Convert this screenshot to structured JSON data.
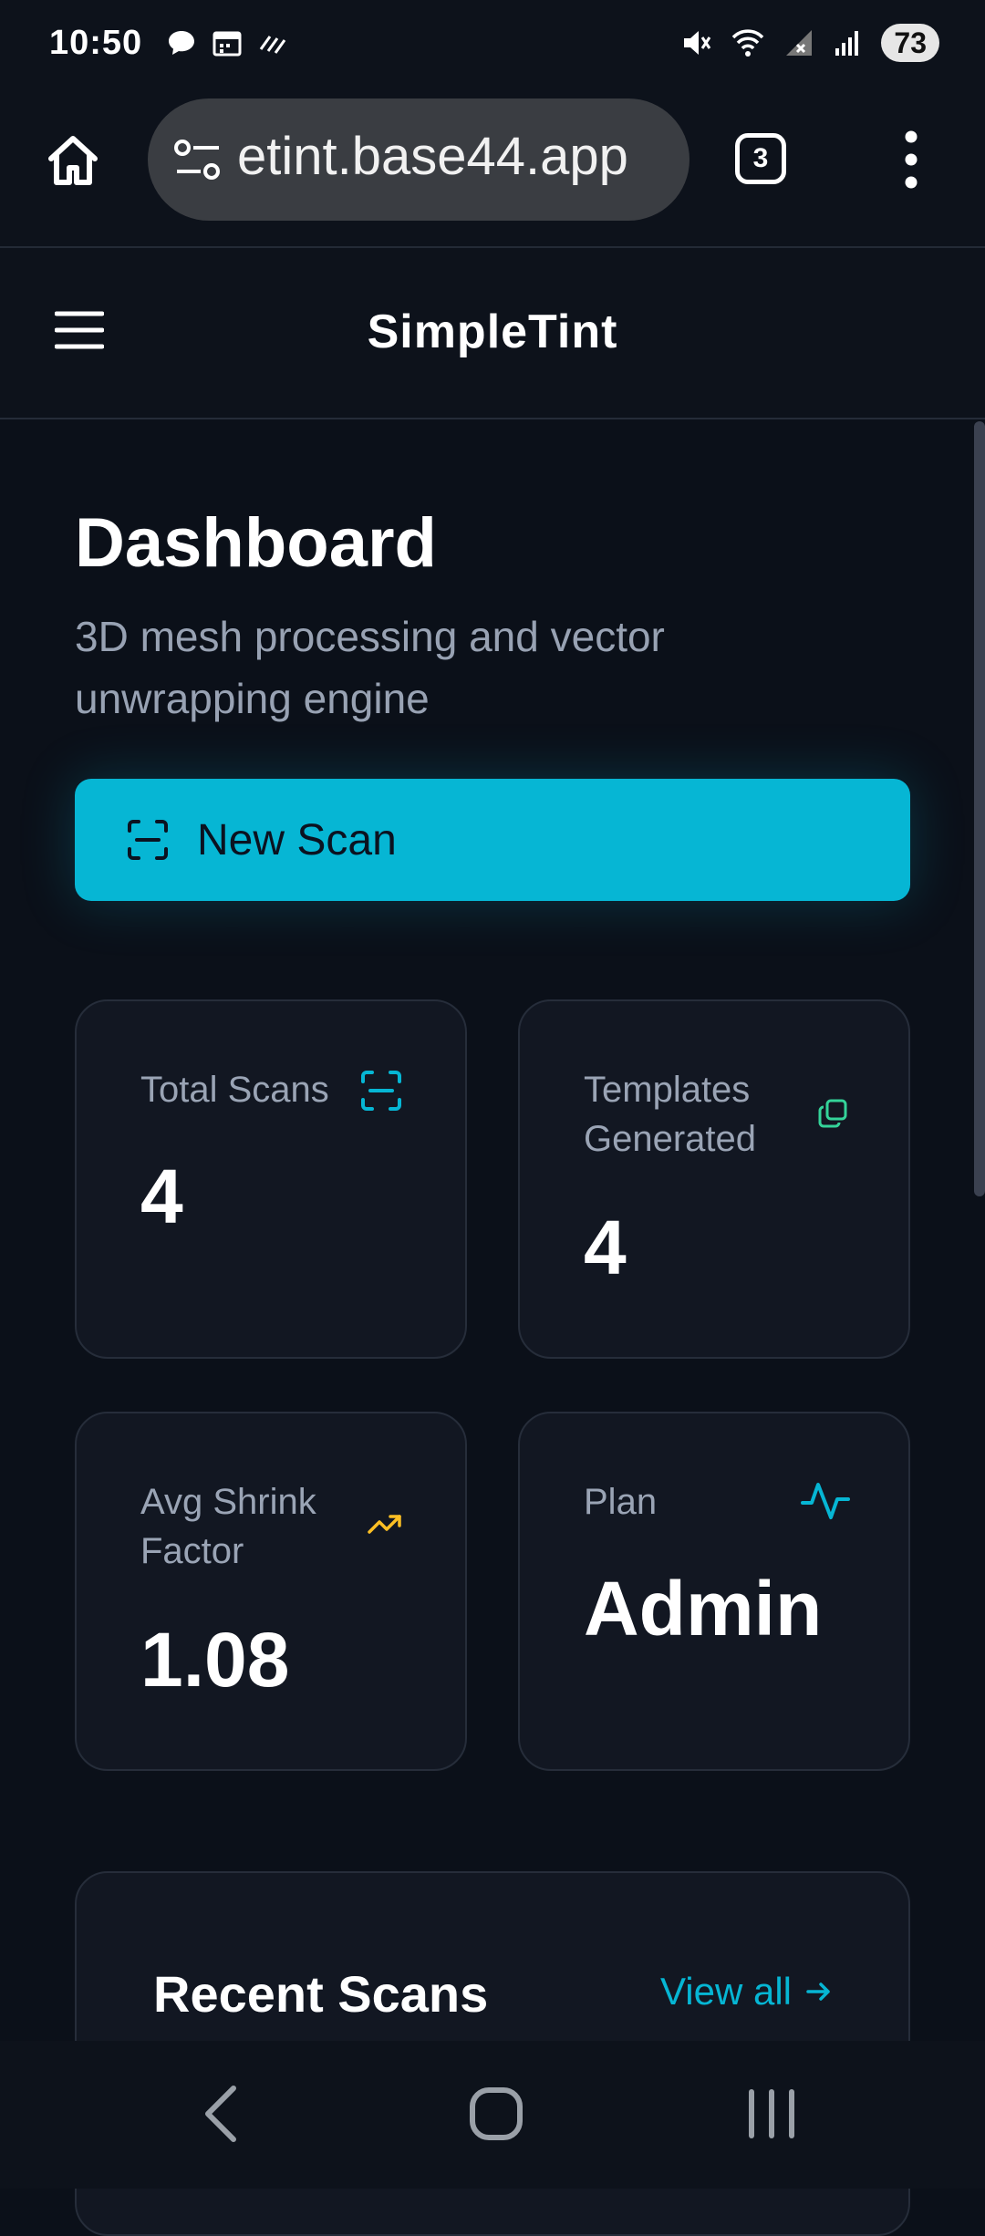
{
  "status_bar": {
    "time": "10:50",
    "battery": "73",
    "left_icons": [
      "chat-icon",
      "calendar-icon",
      "signal-lines-icon"
    ],
    "right_icons": [
      "mute-icon",
      "wifi-icon",
      "no-signal-icon",
      "signal-icon"
    ]
  },
  "browser": {
    "url": "etint.base44.app",
    "tab_count": "3",
    "icons": [
      "home-icon",
      "tune-icon",
      "more-vert-icon"
    ]
  },
  "app": {
    "title": "SimpleTint"
  },
  "dashboard": {
    "title": "Dashboard",
    "subtitle": "3D mesh processing and vector unwrapping engine",
    "new_scan_label": "New Scan"
  },
  "stats": [
    {
      "label": "Total Scans",
      "value": "4",
      "icon": "scan-icon",
      "icon_color": "#06b6d4"
    },
    {
      "label": "Templates Generated",
      "value": "4",
      "icon": "copy-icon",
      "icon_color": "#34d399"
    },
    {
      "label": "Avg Shrink Factor",
      "value": "1.08",
      "icon": "trending-up-icon",
      "icon_color": "#fbbf24"
    },
    {
      "label": "Plan",
      "value": "Admin",
      "icon": "activity-icon",
      "icon_color": "#06b6d4"
    }
  ],
  "recent": {
    "title": "Recent Scans",
    "view_all": "View all"
  },
  "colors": {
    "accent": "#06b6d4",
    "background": "#0b1019",
    "card": "#121722"
  }
}
